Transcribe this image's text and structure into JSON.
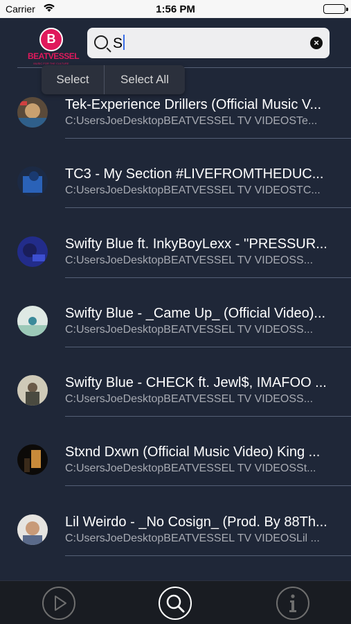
{
  "status_bar": {
    "carrier": "Carrier",
    "time": "1:56 PM"
  },
  "header": {
    "logo_text": "BEATVESSEL",
    "logo_tagline": "MUSIC FOR THE CULTURE",
    "logo_letter": "B"
  },
  "search": {
    "value": "S"
  },
  "edit_menu": {
    "select": "Select",
    "select_all": "Select All"
  },
  "videos": [
    {
      "title": "Tek-Experience Drillers (Official Music V...",
      "path": "C:UsersJoeDesktopBEATVESSEL TV VIDEOSTe..."
    },
    {
      "title": "TC3 - My Section #LIVEFROMTHEDUC...",
      "path": "C:UsersJoeDesktopBEATVESSEL TV VIDEOSTC..."
    },
    {
      "title": "Swifty Blue ft. InkyBoyLexx - ''PRESSUR...",
      "path": "C:UsersJoeDesktopBEATVESSEL TV VIDEOSS..."
    },
    {
      "title": "Swifty Blue - _Came Up_ (Official Video)...",
      "path": "C:UsersJoeDesktopBEATVESSEL TV VIDEOSS..."
    },
    {
      "title": "Swifty Blue - CHECK ft. Jewl$, IMAFOO ...",
      "path": "C:UsersJoeDesktopBEATVESSEL TV VIDEOSS..."
    },
    {
      "title": "Stxnd Dxwn (Official Music Video) King ...",
      "path": "C:UsersJoeDesktopBEATVESSEL TV VIDEOSSt..."
    },
    {
      "title": "Lil Weirdo - _No Cosign_ (Prod. By 88Th...",
      "path": "C:UsersJoeDesktopBEATVESSEL TV VIDEOSLil ..."
    }
  ],
  "tab_bar": {
    "tabs": [
      {
        "icon": "play-icon",
        "active": false
      },
      {
        "icon": "search-icon",
        "active": true
      },
      {
        "icon": "info-icon",
        "active": false
      }
    ]
  },
  "colors": {
    "background": "#1f2738",
    "brand": "#e0195c",
    "separator": "#556076"
  }
}
